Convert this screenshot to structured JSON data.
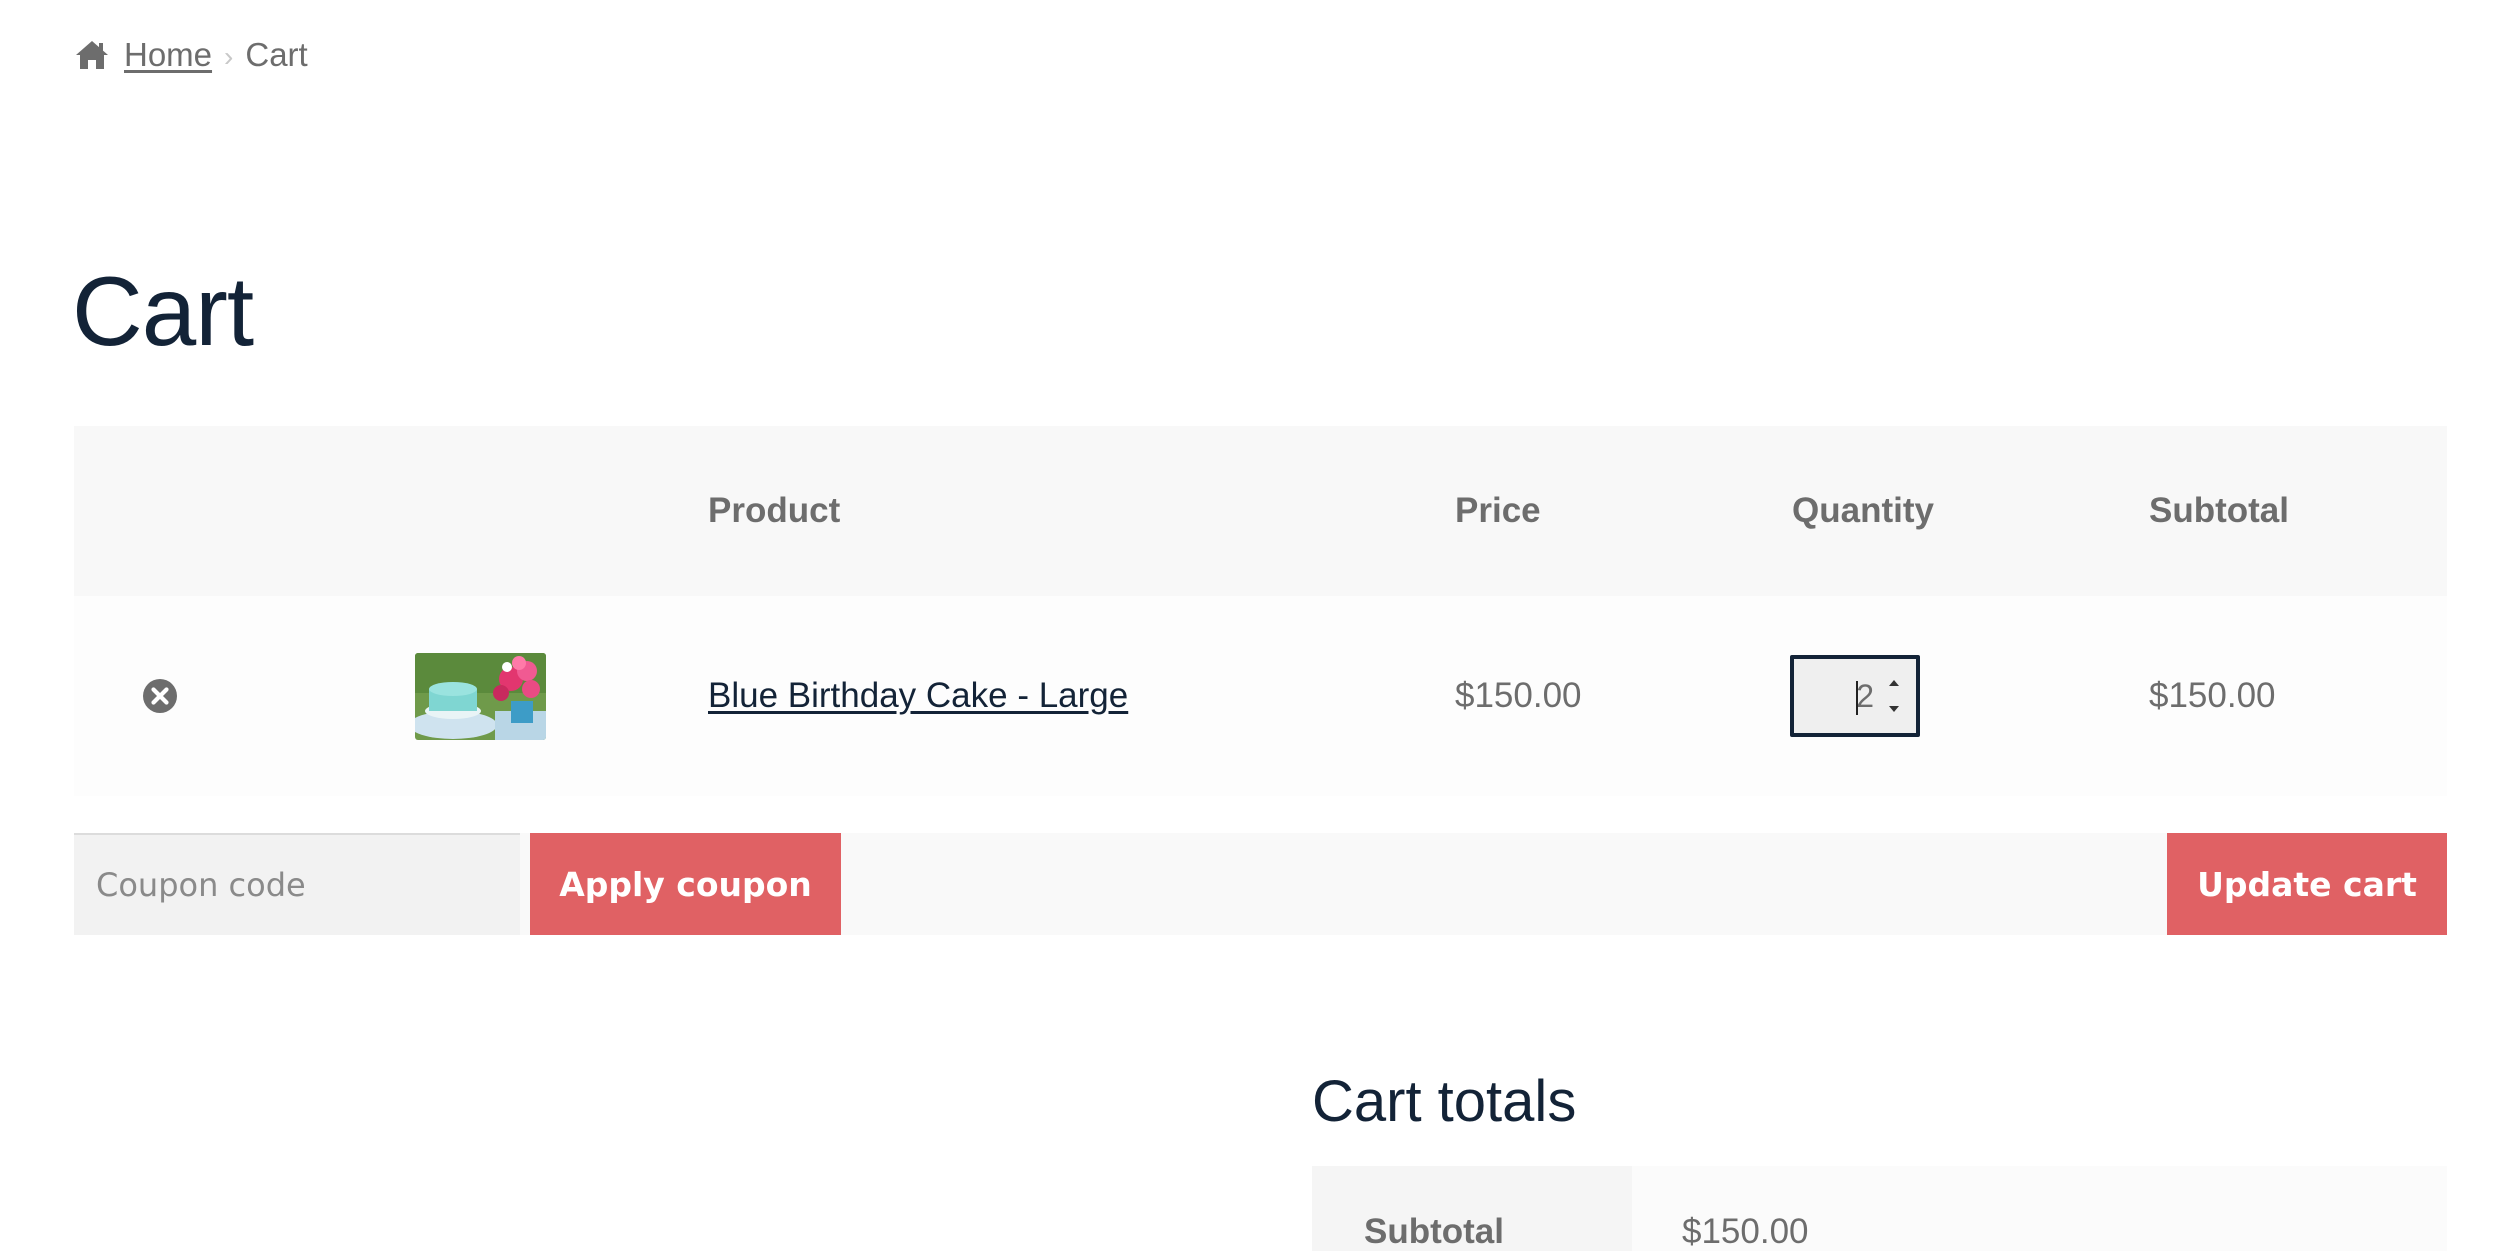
{
  "breadcrumb": {
    "home_icon": "home-icon",
    "home_label": "Home",
    "separator": "›",
    "current": "Cart"
  },
  "page": {
    "title": "Cart"
  },
  "cart_table": {
    "headers": {
      "remove": "",
      "thumbnail": "",
      "product": "Product",
      "price": "Price",
      "quantity": "Quantity",
      "subtotal": "Subtotal"
    },
    "rows": [
      {
        "remove_icon": "remove-circle-icon",
        "thumbnail_icon": "cake-thumbnail",
        "product": "Blue Birthday Cake - Large",
        "price": "$150.00",
        "quantity": "2",
        "subtotal": "$150.00"
      }
    ]
  },
  "actions": {
    "coupon_placeholder": "Coupon code",
    "apply_label": "Apply coupon",
    "update_label": "Update cart"
  },
  "totals": {
    "title": "Cart totals",
    "subtotal_label": "Subtotal",
    "subtotal_value": "$150.00"
  },
  "colors": {
    "heading": "#132337",
    "text": "#6d6d6d",
    "accent_button": "#e06164",
    "table_header_bg": "#f8f8f8"
  }
}
